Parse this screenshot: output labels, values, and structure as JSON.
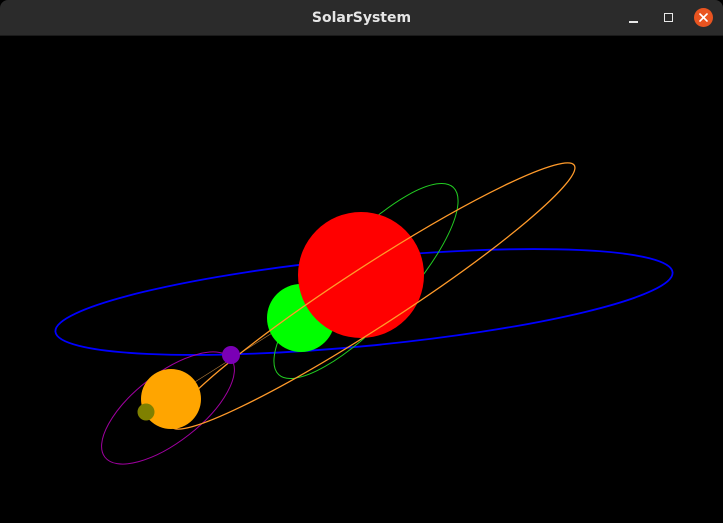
{
  "window": {
    "title": "SolarSystem",
    "buttons": {
      "minimize_icon": "minimize-icon",
      "maximize_icon": "maximize-icon",
      "close_icon": "close-icon"
    },
    "colors": {
      "titlebar": "#2b2b2b",
      "title_text": "#e6e6e6",
      "close_button": "#e95420"
    }
  },
  "scene": {
    "background": "#000000",
    "bodies": [
      {
        "name": "sun",
        "color": "#ff0000"
      },
      {
        "name": "planet-green",
        "color": "#00ff00"
      },
      {
        "name": "planet-purple",
        "color": "#7a00b5"
      },
      {
        "name": "planet-orange",
        "color": "#ffa500"
      },
      {
        "name": "moon-olive",
        "color": "#7f8000"
      }
    ],
    "orbits": [
      {
        "name": "orbit-blue",
        "color": "#0000ff"
      },
      {
        "name": "orbit-orange",
        "color": "#ff9a2a"
      },
      {
        "name": "orbit-green",
        "color": "#22cc22"
      },
      {
        "name": "orbit-purple",
        "color": "#a000a0"
      }
    ]
  }
}
